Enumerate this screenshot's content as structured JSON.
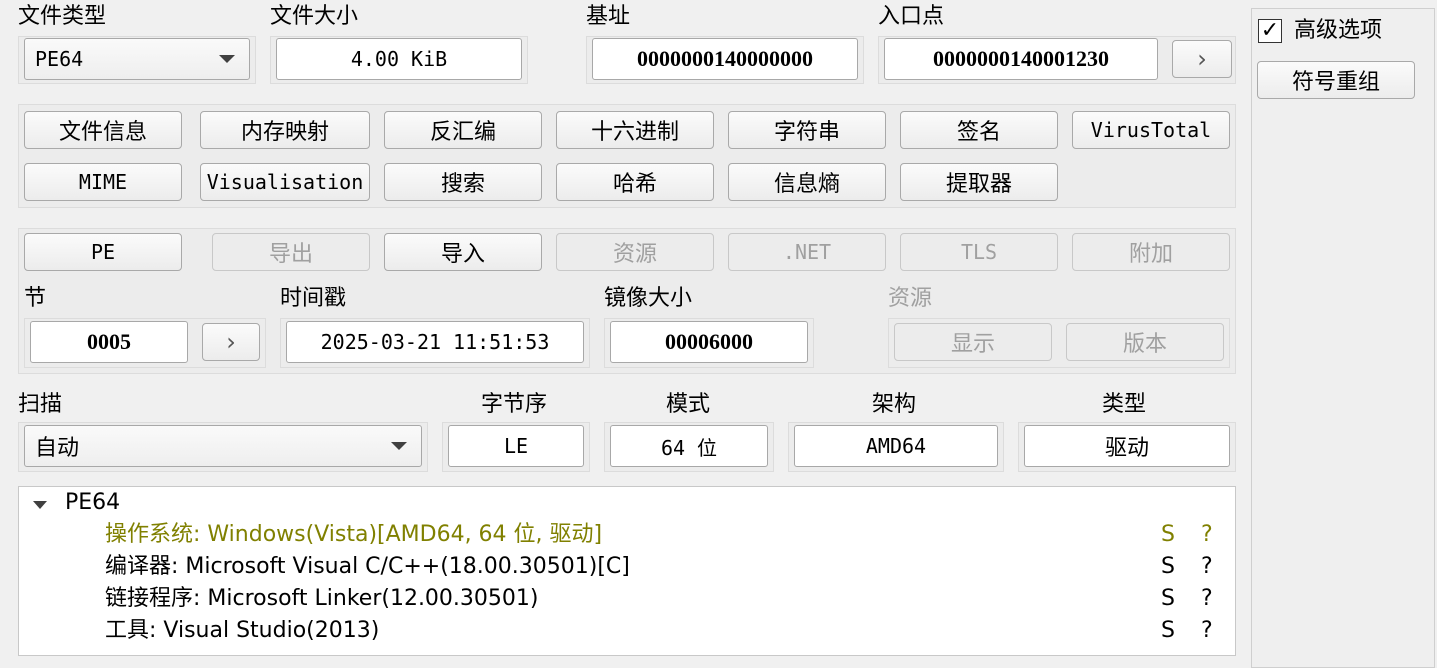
{
  "top": {
    "file_type_label": "文件类型",
    "file_type_value": "PE64",
    "file_size_label": "文件大小",
    "file_size_value": "4.00 KiB",
    "base_label": "基址",
    "base_value": "0000000140000000",
    "entry_label": "入口点",
    "entry_value": "0000000140001230",
    "entry_btn": "›"
  },
  "tools": {
    "row1": [
      "文件信息",
      "内存映射",
      "反汇编",
      "十六进制",
      "字符串",
      "签名",
      "VirusTotal"
    ],
    "row2": [
      "MIME",
      "Visualisation",
      "搜索",
      "哈希",
      "信息熵",
      "提取器"
    ]
  },
  "pe": {
    "buttons": [
      "PE",
      "导出",
      "导入",
      "资源",
      ".NET",
      "TLS",
      "附加"
    ],
    "section_label": "节",
    "section_value": "0005",
    "section_btn": "›",
    "timestamp_label": "时间戳",
    "timestamp_value": "2025-03-21 11:51:53",
    "image_size_label": "镜像大小",
    "image_size_value": "00006000",
    "resources_label": "资源",
    "show_btn": "显示",
    "version_btn": "版本"
  },
  "scan": {
    "scan_label": "扫描",
    "scan_value": "自动",
    "endian_label": "字节序",
    "endian_value": "LE",
    "mode_label": "模式",
    "mode_value": "64 位",
    "arch_label": "架构",
    "arch_value": "AMD64",
    "type_label": "类型",
    "type_value": "驱动"
  },
  "results": {
    "root": "PE64",
    "rows": [
      {
        "text": "操作系统: Windows(Vista)[AMD64, 64 位, 驱动]",
        "s": "S",
        "q": "?",
        "color": "#808000"
      },
      {
        "text": "编译器: Microsoft Visual C/C++(18.00.30501)[C]",
        "s": "S",
        "q": "?",
        "color": "#000000"
      },
      {
        "text": "链接程序: Microsoft Linker(12.00.30501)",
        "s": "S",
        "q": "?",
        "color": "#000000"
      },
      {
        "text": "工具: Visual Studio(2013)",
        "s": "S",
        "q": "?",
        "color": "#000000"
      }
    ]
  },
  "side": {
    "advanced_label": "高级选项",
    "advanced_checked": "✓",
    "demangle_btn": "符号重组"
  }
}
